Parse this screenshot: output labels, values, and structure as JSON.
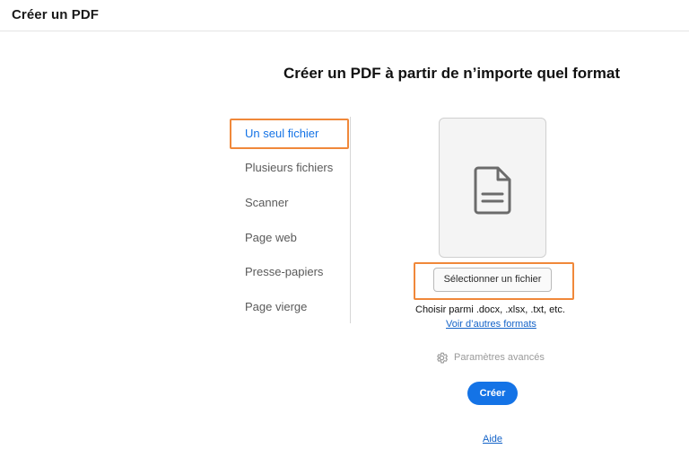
{
  "header": {
    "title": "Créer un PDF"
  },
  "main": {
    "heading": "Créer un PDF à partir de n’importe quel format"
  },
  "sidebar": {
    "items": [
      {
        "label": "Un seul fichier",
        "active": true
      },
      {
        "label": "Plusieurs fichiers",
        "active": false
      },
      {
        "label": "Scanner",
        "active": false
      },
      {
        "label": "Page web",
        "active": false
      },
      {
        "label": "Presse-papiers",
        "active": false
      },
      {
        "label": "Page vierge",
        "active": false
      }
    ]
  },
  "upload": {
    "card_icon": "document-icon",
    "select_button_label": "Sélectionner un fichier",
    "formats_text": "Choisir parmi .docx, .xlsx, .txt, etc.",
    "formats_link": "Voir d’autres formats",
    "advanced_icon": "gear-icon",
    "advanced_label": "Paramètres avancés",
    "create_button_label": "Créer",
    "help_link": "Aide"
  },
  "colors": {
    "accent": "#1473e6",
    "highlight_outline": "#f0883a",
    "link": "#1463c8"
  }
}
